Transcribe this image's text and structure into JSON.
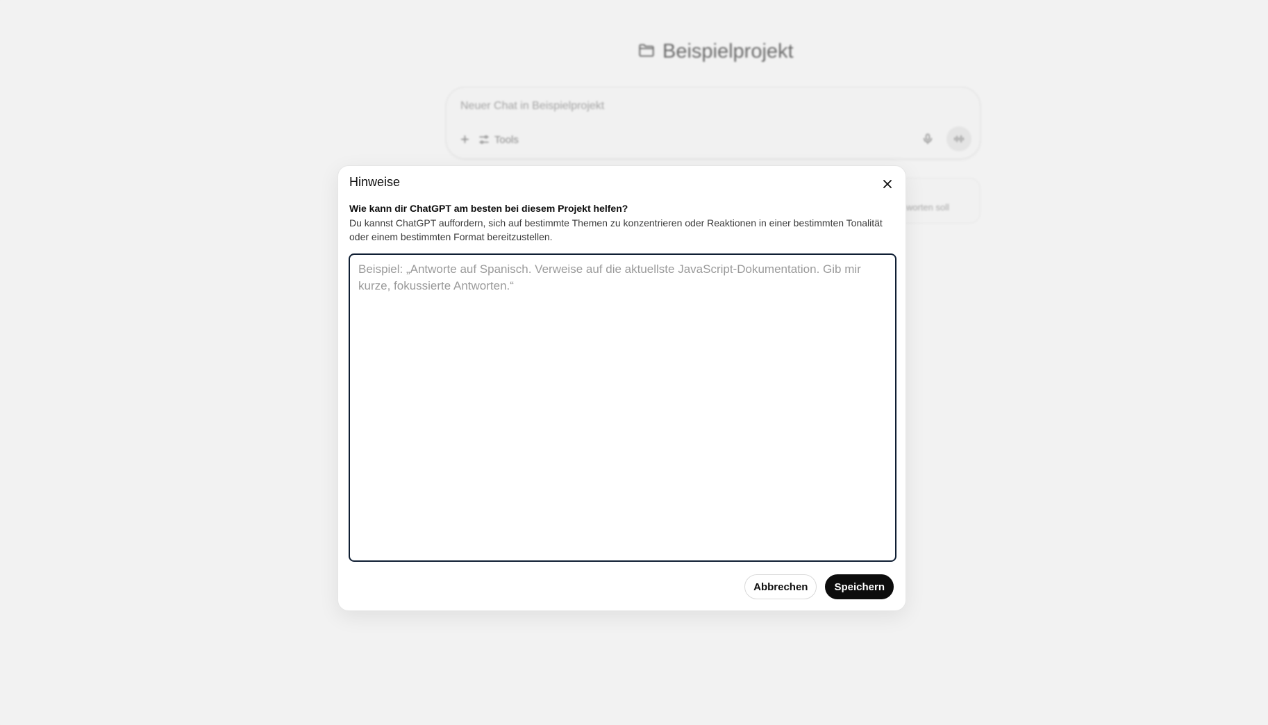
{
  "project": {
    "title": "Beispielprojekt",
    "icon": "folder-icon"
  },
  "composer": {
    "placeholder": "Neuer Chat in Beispielprojekt",
    "tools_label": "Tools",
    "icons": [
      "plus-icon",
      "sliders-icon",
      "microphone-icon",
      "voice-mode-icon"
    ]
  },
  "instructions_card": {
    "snippet": "worten soll"
  },
  "modal": {
    "title": "Hinweise",
    "question": "Wie kann dir ChatGPT am besten bei diesem Projekt helfen?",
    "description": "Du kannst ChatGPT auffordern, sich auf bestimmte Themen zu konzentrieren oder Reaktionen in einer bestimmten Tonalität oder einem bestimmten Format bereitzustellen.",
    "textarea_placeholder": "Beispiel: „Antworte auf Spanisch. Verweise auf die aktuellste JavaScript-Dokumentation. Gib mir kurze, fokussierte Antworten.“",
    "textarea_value": "",
    "cancel_label": "Abbrechen",
    "save_label": "Speichern"
  },
  "colors": {
    "background": "#f2f2f2",
    "modal_bg": "#ffffff",
    "focus_border": "#0f1e33",
    "primary_button": "#0d0d0d"
  }
}
